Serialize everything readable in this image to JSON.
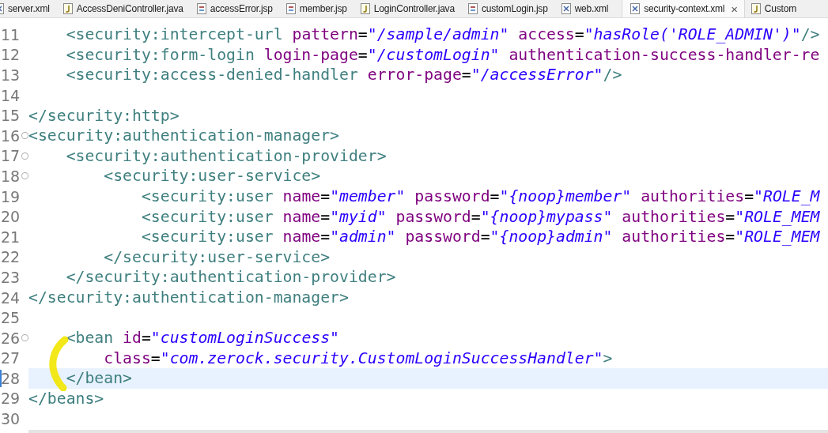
{
  "tabs": [
    {
      "label": "server.xml",
      "kind": "xml",
      "selected": false
    },
    {
      "label": "AccessDeniController.java",
      "kind": "java",
      "selected": false
    },
    {
      "label": "accessError.jsp",
      "kind": "jsp",
      "selected": false
    },
    {
      "label": "member.jsp",
      "kind": "jsp",
      "selected": false
    },
    {
      "label": "LoginController.java",
      "kind": "java",
      "selected": false
    },
    {
      "label": "customLogin.jsp",
      "kind": "jsp",
      "selected": false
    },
    {
      "label": "web.xml",
      "kind": "xml",
      "selected": false
    },
    {
      "label": "security-context.xml",
      "kind": "xml",
      "selected": true,
      "close": "×"
    },
    {
      "label": "Custom",
      "kind": "java",
      "selected": false
    }
  ],
  "editor": {
    "lines": [
      {
        "number": "11",
        "foldable": false,
        "current": false,
        "tokens": [
          {
            "kind": "tag",
            "text": "    <security:intercept-url "
          },
          {
            "kind": "attr",
            "text": "pattern"
          },
          {
            "kind": "eq",
            "text": "="
          },
          {
            "kind": "value",
            "text": "\"/sample/admin\""
          },
          {
            "kind": "attr",
            "text": " access"
          },
          {
            "kind": "eq",
            "text": "="
          },
          {
            "kind": "value",
            "text": "\"hasRole('ROLE_ADMIN')\""
          },
          {
            "kind": "tag",
            "text": "/>"
          }
        ]
      },
      {
        "number": "12",
        "foldable": false,
        "current": false,
        "tokens": [
          {
            "kind": "tag",
            "text": "    <security:form-login "
          },
          {
            "kind": "attr",
            "text": "login-page"
          },
          {
            "kind": "eq",
            "text": "="
          },
          {
            "kind": "value",
            "text": "\"/customLogin\""
          },
          {
            "kind": "attr",
            "text": " authentication-success-handler-re"
          }
        ]
      },
      {
        "number": "13",
        "foldable": false,
        "current": false,
        "tokens": [
          {
            "kind": "tag",
            "text": "    <security:access-denied-handler "
          },
          {
            "kind": "attr",
            "text": "error-page"
          },
          {
            "kind": "eq",
            "text": "="
          },
          {
            "kind": "value",
            "text": "\"/accessError\""
          },
          {
            "kind": "tag",
            "text": "/>"
          }
        ]
      },
      {
        "number": "14",
        "foldable": false,
        "current": false
      },
      {
        "number": "15",
        "foldable": false,
        "current": false,
        "tokens": [
          {
            "kind": "tag",
            "text": "</security:http>"
          }
        ]
      },
      {
        "number": "16",
        "foldable": true,
        "current": false,
        "tokens": [
          {
            "kind": "tag",
            "text": "<security:authentication-manager>"
          }
        ]
      },
      {
        "number": "17",
        "foldable": true,
        "current": false,
        "tokens": [
          {
            "kind": "tag",
            "text": "    <security:authentication-provider>"
          }
        ]
      },
      {
        "number": "18",
        "foldable": true,
        "current": false,
        "tokens": [
          {
            "kind": "tag",
            "text": "        <security:user-service>"
          }
        ]
      },
      {
        "number": "19",
        "foldable": false,
        "current": false,
        "tokens": [
          {
            "kind": "tag",
            "text": "            <security:user "
          },
          {
            "kind": "attr",
            "text": "name"
          },
          {
            "kind": "eq",
            "text": "="
          },
          {
            "kind": "value",
            "text": "\"member\""
          },
          {
            "kind": "attr",
            "text": " password"
          },
          {
            "kind": "eq",
            "text": "="
          },
          {
            "kind": "value",
            "text": "\"{noop}member\""
          },
          {
            "kind": "attr",
            "text": " authorities"
          },
          {
            "kind": "eq",
            "text": "="
          },
          {
            "kind": "value",
            "text": "\"ROLE_M"
          }
        ]
      },
      {
        "number": "20",
        "foldable": false,
        "current": false,
        "tokens": [
          {
            "kind": "tag",
            "text": "            <security:user "
          },
          {
            "kind": "attr",
            "text": "name"
          },
          {
            "kind": "eq",
            "text": "="
          },
          {
            "kind": "value",
            "text": "\"myid\""
          },
          {
            "kind": "attr",
            "text": " password"
          },
          {
            "kind": "eq",
            "text": "="
          },
          {
            "kind": "value",
            "text": "\"{noop}mypass\""
          },
          {
            "kind": "attr",
            "text": " authorities"
          },
          {
            "kind": "eq",
            "text": "="
          },
          {
            "kind": "value",
            "text": "\"ROLE_MEM"
          }
        ]
      },
      {
        "number": "21",
        "foldable": false,
        "current": false,
        "tokens": [
          {
            "kind": "tag",
            "text": "            <security:user "
          },
          {
            "kind": "attr",
            "text": "name"
          },
          {
            "kind": "eq",
            "text": "="
          },
          {
            "kind": "value",
            "text": "\"admin\""
          },
          {
            "kind": "attr",
            "text": " password"
          },
          {
            "kind": "eq",
            "text": "="
          },
          {
            "kind": "value",
            "text": "\"{noop}admin\""
          },
          {
            "kind": "attr",
            "text": " authorities"
          },
          {
            "kind": "eq",
            "text": "="
          },
          {
            "kind": "value",
            "text": "\"ROLE_MEM"
          }
        ]
      },
      {
        "number": "22",
        "foldable": false,
        "current": false,
        "tokens": [
          {
            "kind": "tag",
            "text": "        </security:user-service>"
          }
        ]
      },
      {
        "number": "23",
        "foldable": false,
        "current": false,
        "tokens": [
          {
            "kind": "tag",
            "text": "    </security:authentication-provider>"
          }
        ]
      },
      {
        "number": "24",
        "foldable": false,
        "current": false,
        "tokens": [
          {
            "kind": "tag",
            "text": "</security:authentication-manager>"
          }
        ]
      },
      {
        "number": "25",
        "foldable": false,
        "current": false
      },
      {
        "number": "26",
        "foldable": true,
        "current": false,
        "tokens": [
          {
            "kind": "tag",
            "text": "    <bean "
          },
          {
            "kind": "attr",
            "text": "id"
          },
          {
            "kind": "eq",
            "text": "="
          },
          {
            "kind": "value",
            "text": "\"customLoginSuccess\""
          }
        ]
      },
      {
        "number": "27",
        "foldable": false,
        "current": false,
        "tokens": [
          {
            "kind": "attr",
            "text": "        class"
          },
          {
            "kind": "eq",
            "text": "="
          },
          {
            "kind": "value",
            "text": "\"com.zerock.security.CustomLoginSuccessHandler\""
          },
          {
            "kind": "tag",
            "text": ">"
          }
        ]
      },
      {
        "number": "28",
        "foldable": false,
        "current": true,
        "tokens": [
          {
            "kind": "tag",
            "text": "    </bean>"
          }
        ]
      },
      {
        "number": "29",
        "foldable": false,
        "current": false,
        "tokens": [
          {
            "kind": "tag",
            "text": "</beans>"
          }
        ]
      },
      {
        "number": "30",
        "foldable": false,
        "current": false
      }
    ]
  }
}
